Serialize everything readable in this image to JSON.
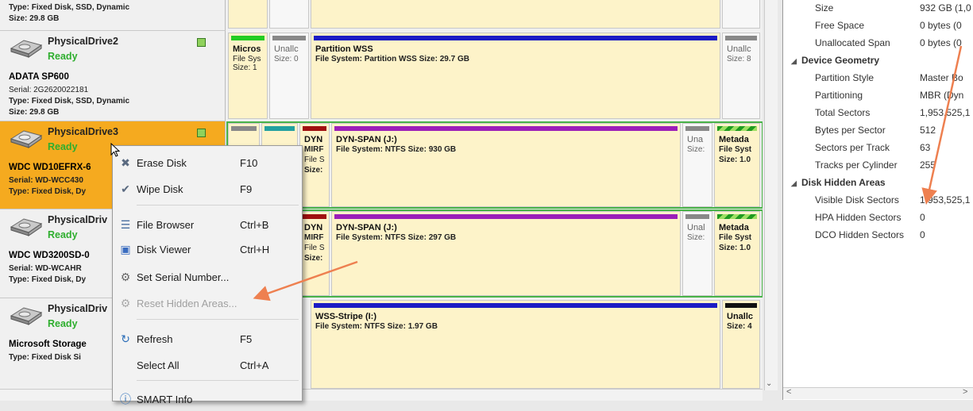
{
  "drives": [
    {
      "name": "",
      "status": "",
      "model": "",
      "lines": [
        "Type: Fixed Disk, SSD, Dynamic",
        "Size: 29.8 GB"
      ],
      "partitions": []
    },
    {
      "name": "PhysicalDrive2",
      "status": "Ready",
      "model": "ADATA SP600",
      "lines": [
        "Serial: 2G2620022181",
        "Type: Fixed Disk, SSD, Dynamic",
        "Size: 29.8 GB"
      ],
      "partitions": [
        {
          "title": "Micros",
          "line1": "File Sys",
          "line2": "Size: 1",
          "bar": "#22cc22",
          "unalloc": false
        },
        {
          "title": "Unallc",
          "line1": "Size: 0",
          "line2": "",
          "bar": "#888888",
          "unalloc": true
        },
        {
          "title": "Partition WSS",
          "line1": "File System: Partition WSS Size: 29.7 GB",
          "line2": "",
          "bar": "#1c1cc4",
          "unalloc": false
        },
        {
          "title": "Unallc",
          "line1": "Size: 8",
          "line2": "",
          "bar": "#888888",
          "unalloc": true
        }
      ]
    },
    {
      "name": "PhysicalDrive3",
      "status": "Ready",
      "model": "WDC WD10EFRX-6",
      "lines": [
        "Serial: WD-WCC430",
        "Type: Fixed Disk, Dy"
      ],
      "partitions": [
        {
          "title": "DYN",
          "line1": "MIRF",
          "line2": "File S",
          "line3": "Size:",
          "bar": "#a01010",
          "unalloc": false
        },
        {
          "title": "DYN-SPAN (J:)",
          "line1": "File System: NTFS Size: 930 GB",
          "line2": "",
          "bar": "#9b1fb8",
          "unalloc": false
        },
        {
          "title": "Una",
          "line1": "Size:",
          "line2": "",
          "bar": "#888888",
          "unalloc": true
        },
        {
          "title": "Metada",
          "line1": "File Syst",
          "line2": "Size: 1.0",
          "bar": "meta",
          "unalloc": false
        }
      ]
    },
    {
      "name": "PhysicalDriv",
      "status": "Ready",
      "model": "WDC WD3200SD-0",
      "lines": [
        "Serial: WD-WCAHR",
        "Type: Fixed Disk, Dy"
      ],
      "partitions": [
        {
          "title": "DYN",
          "line1": "MIRF",
          "line2": "File S",
          "line3": "Size:",
          "bar": "#a01010",
          "unalloc": false
        },
        {
          "title": "DYN-SPAN (J:)",
          "line1": "File System: NTFS Size: 297 GB",
          "line2": "",
          "bar": "#9b1fb8",
          "unalloc": false
        },
        {
          "title": "Unal",
          "line1": "Size:",
          "line2": "",
          "bar": "#888888",
          "unalloc": true
        },
        {
          "title": "Metada",
          "line1": "File Syst",
          "line2": "Size: 1.0",
          "bar": "meta",
          "unalloc": false
        }
      ]
    },
    {
      "name": "PhysicalDriv",
      "status": "Ready",
      "model": "Microsoft Storage",
      "lines": [
        "Type: Fixed Disk  Si"
      ],
      "partitions": [
        {
          "title": "WSS-Stripe (I:)",
          "line1": "File System: NTFS Size: 1.97 GB",
          "line2": "",
          "bar": "#1c1cc4",
          "unalloc": false
        },
        {
          "title": "Unallc",
          "line1": "Size: 4",
          "line2": "",
          "bar": "#111111",
          "unalloc": false
        }
      ]
    }
  ],
  "properties": [
    {
      "kind": "row",
      "key": "Size",
      "value": "932 GB (1,0"
    },
    {
      "kind": "row",
      "key": "Free Space",
      "value": "0 bytes (0"
    },
    {
      "kind": "row",
      "key": "Unallocated Span",
      "value": "0 bytes (0"
    },
    {
      "kind": "cat",
      "key": "Device Geometry"
    },
    {
      "kind": "row",
      "key": "Partition Style",
      "value": "Master Bo"
    },
    {
      "kind": "row",
      "key": "Partitioning",
      "value": "MBR (Dyn"
    },
    {
      "kind": "row",
      "key": "Total Sectors",
      "value": "1,953,525,1"
    },
    {
      "kind": "row",
      "key": "Bytes per Sector",
      "value": "512"
    },
    {
      "kind": "row",
      "key": "Sectors per Track",
      "value": "63"
    },
    {
      "kind": "row",
      "key": "Tracks per Cylinder",
      "value": "255"
    },
    {
      "kind": "cat",
      "key": "Disk Hidden Areas"
    },
    {
      "kind": "row",
      "key": "Visible Disk Sectors",
      "value": "1,953,525,1"
    },
    {
      "kind": "row",
      "key": "HPA Hidden Sectors",
      "value": "0"
    },
    {
      "kind": "row",
      "key": "DCO Hidden Sectors",
      "value": "0"
    }
  ],
  "context_menu": {
    "items": [
      {
        "label": "Erase Disk",
        "shortcut": "F10",
        "icon": "erase-disk-icon",
        "enabled": true
      },
      {
        "label": "Wipe Disk",
        "shortcut": "F9",
        "icon": "wipe-disk-icon",
        "enabled": true
      },
      {
        "label": "File Browser",
        "shortcut": "Ctrl+B",
        "icon": "file-browser-icon",
        "enabled": true
      },
      {
        "label": "Disk Viewer",
        "shortcut": "Ctrl+H",
        "icon": "disk-viewer-icon",
        "enabled": true
      },
      {
        "label": "Set Serial Number...",
        "shortcut": "",
        "icon": "serial-number-icon",
        "enabled": true
      },
      {
        "label": "Reset Hidden Areas...",
        "shortcut": "",
        "icon": "reset-hidden-icon",
        "enabled": false
      },
      {
        "label": "Refresh",
        "shortcut": "F5",
        "icon": "refresh-icon",
        "enabled": true
      },
      {
        "label": "Select All",
        "shortcut": "Ctrl+A",
        "icon": "",
        "enabled": true
      },
      {
        "label": "SMART Info",
        "shortcut": "",
        "icon": "info-icon",
        "enabled": true
      }
    ]
  },
  "colors": {
    "selected_row": "#f5aa1f",
    "ready_green": "#2eae2e",
    "annotation_arrow": "#ee8050"
  }
}
